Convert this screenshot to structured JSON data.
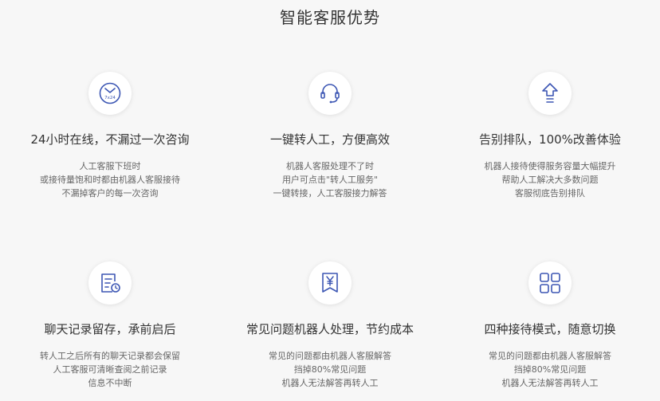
{
  "page_title": "智能客服优势",
  "colors": {
    "icon": "#3d57b4",
    "title_text": "#333333",
    "desc_text": "#666666",
    "background": "#f7f7f7"
  },
  "features": [
    {
      "icon": "clock-7x24-icon",
      "icon_text": "7x24",
      "title": "24小时在线，不漏过一次咨询",
      "desc": [
        "人工客服下班时",
        "或接待量饱和时都由机器人客服接待",
        "不漏掉客户的每一次咨询"
      ]
    },
    {
      "icon": "headset-icon",
      "title": "一键转人工，方便高效",
      "desc": [
        "机器人客服处理不了时",
        "用户可点击\"转人工服务\"",
        "一键转接，人工客服接力解答"
      ]
    },
    {
      "icon": "upgrade-arrow-icon",
      "title": "告别排队，100%改善体验",
      "desc": [
        "机器人接待使得服务容量大幅提升",
        "帮助人工解决大多数问题",
        "客服彻底告别排队"
      ]
    },
    {
      "icon": "chat-record-icon",
      "title": "聊天记录留存，承前启后",
      "desc": [
        "转人工之后所有的聊天记录都会保留",
        "人工客服可清晰查阅之前记录",
        "信息不中断"
      ]
    },
    {
      "icon": "yen-bookmark-icon",
      "title": "常见问题机器人处理，节约成本",
      "desc": [
        "常见的问题都由机器人客服解答",
        "挡掉80%常见问题",
        "机器人无法解答再转人工"
      ]
    },
    {
      "icon": "grid-modes-icon",
      "title": "四种接待模式，随意切换",
      "desc": [
        "常见的问题都由机器人客服解答",
        "挡掉80%常见问题",
        "机器人无法解答再转人工"
      ]
    }
  ]
}
